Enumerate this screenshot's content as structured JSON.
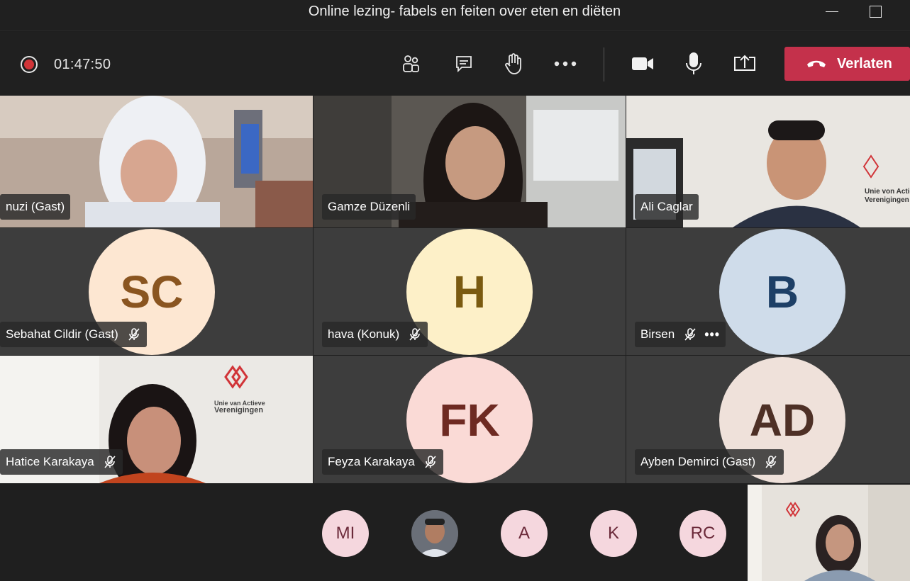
{
  "window": {
    "title": "Online lezing- fabels en feiten over eten en diëten"
  },
  "toolbar": {
    "timer": "01:47:50",
    "icons": [
      "participants-icon",
      "chat-icon",
      "raise-hand-icon",
      "more-icon",
      "camera-icon",
      "microphone-icon",
      "share-screen-icon"
    ],
    "leave_label": "Verlaten",
    "leave_color": "#c4314b",
    "record_color": "#d13438"
  },
  "tiles": [
    {
      "name": "nuzi (Gast)",
      "video": true,
      "muted": false
    },
    {
      "name": "Gamze Düzenli",
      "video": true,
      "muted": false
    },
    {
      "name": "Ali Caglar",
      "video": true,
      "muted": false
    },
    {
      "name": "Sebahat Cildir (Gast)",
      "video": false,
      "initials": "SC",
      "avatar_bg": "#fde7d2",
      "avatar_fg": "#8a5520",
      "muted": true
    },
    {
      "name": "hava (Konuk)",
      "video": false,
      "initials": "H",
      "avatar_bg": "#fdf0c8",
      "avatar_fg": "#7a5a10",
      "muted": true
    },
    {
      "name": "Birsen",
      "video": false,
      "initials": "B",
      "avatar_bg": "#cfdcea",
      "avatar_fg": "#1d3f66",
      "muted": true,
      "more": "•••"
    },
    {
      "name": "Hatice Karakaya",
      "video": true,
      "muted": true
    },
    {
      "name": "Feyza Karakaya",
      "video": false,
      "initials": "FK",
      "avatar_bg": "#fadad6",
      "avatar_fg": "#6e2a22",
      "muted": true
    },
    {
      "name": "Ayben Demirci (Gast)",
      "video": false,
      "initials": "AD",
      "avatar_bg": "#efe1da",
      "avatar_fg": "#4e3026",
      "muted": true
    }
  ],
  "overflow": [
    {
      "initials": "MI"
    },
    {
      "initials": "",
      "photo": true
    },
    {
      "initials": "A"
    },
    {
      "initials": "K"
    },
    {
      "initials": "RC"
    }
  ],
  "logo_text": {
    "line1": "Unie van Actieve",
    "line2": "Verenigingen"
  }
}
